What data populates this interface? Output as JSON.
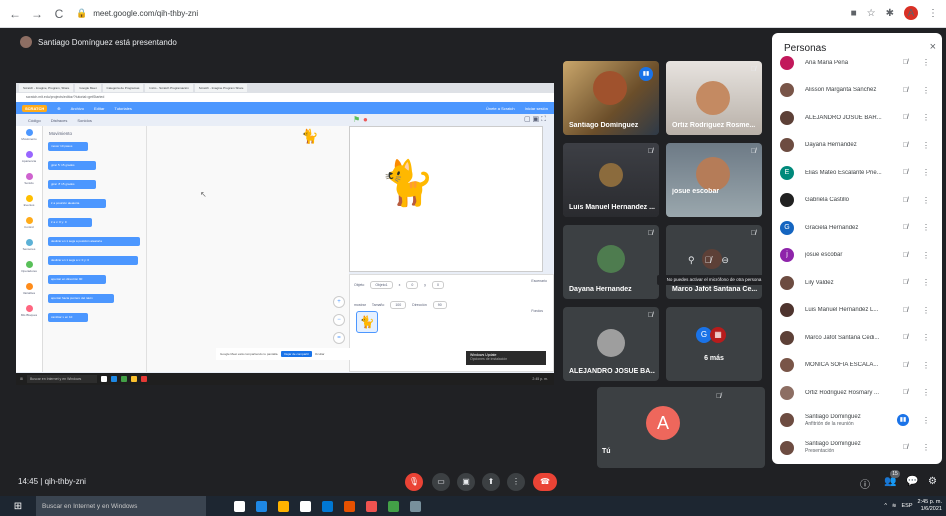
{
  "browser": {
    "back": "←",
    "forward": "→",
    "reload": "C",
    "url": "meet.google.com/qih-thby-zni"
  },
  "meet": {
    "presenter_banner": "Santiago Domínguez está presentando",
    "meeting_time": "14:45",
    "meeting_code": "qih-thby-zni",
    "hover_tooltip": "No puedes activar el micrófono de otra persona"
  },
  "shared_screen": {
    "tabs": [
      "Scratch - Imagine, Program, Share",
      "Google Meet",
      "Categoría de Programas",
      "Inicio - Scratch Programación",
      "Scratch - Imagine Program Share"
    ],
    "address": "scratch.mit.edu/projects/editor/?tutorial=getStarted",
    "menu": [
      "Archivo",
      "Editar",
      "Tutoriales"
    ],
    "menu_right": [
      "Únete a Scratch",
      "Iniciar sesión"
    ],
    "logo": "SCRATCH",
    "editor_tabs": [
      "Código",
      "Disfraces",
      "Sonidos"
    ],
    "categories": [
      {
        "label": "Movimiento",
        "color": "#4c97ff"
      },
      {
        "label": "Apariencia",
        "color": "#9966ff"
      },
      {
        "label": "Sonido",
        "color": "#cf63cf"
      },
      {
        "label": "Eventos",
        "color": "#ffbf00"
      },
      {
        "label": "Control",
        "color": "#ffab19"
      },
      {
        "label": "Sensores",
        "color": "#5cb1d6"
      },
      {
        "label": "Operadores",
        "color": "#59c059"
      },
      {
        "label": "Variables",
        "color": "#ff8c1a"
      },
      {
        "label": "Mis Bloques",
        "color": "#ff6680"
      }
    ],
    "palette_title": "Movimiento",
    "blocks": [
      "mover 10 pasos",
      "girar ↻ 15 grados",
      "girar ↺ 15 grados",
      "ir a posición aleatoria",
      "ir a x: 0 y: 0",
      "deslizar en 1 segs a posición aleatoria",
      "deslizar en 1 segs a x: 0 y: 0",
      "apuntar en dirección 90",
      "apuntar hacia puntero del ratón",
      "cambiar x en 10"
    ],
    "sprite_panel": {
      "sprite_label": "Objeto",
      "sprite_name": "Objeto1",
      "x_label": "x",
      "x_value": "0",
      "y_label": "y",
      "y_value": "0",
      "show_label": "mostrar",
      "size_label": "Tamaño",
      "size_value": "100",
      "dir_label": "Dirección",
      "dir_value": "90",
      "stage_label": "Escenario",
      "sprite_thumb": "Objeto1",
      "backdrops": "Fondos"
    },
    "notice": "Google Meet está compartiendo tu pantalla.",
    "notice_stop": "Dejar de compartir",
    "notice_hide": "Ocultar",
    "update_title": "Windows Update",
    "update_text": "Opciones de instalación",
    "taskbar_search": "Buscar en Internet y en Windows"
  },
  "tiles": [
    {
      "name": "Santiago Domínguez",
      "speaking": true
    },
    {
      "name": "Ortiz Rodriguez Rosme..."
    },
    {
      "name": "Luis Manuel Hernandez ..."
    },
    {
      "name": "josue escobar"
    },
    {
      "name": "Dayana Hernandez"
    },
    {
      "name": "Marco Jafot Santana Ce..."
    },
    {
      "name": "ALEJANDRO JOSUE BA..."
    },
    {
      "more_label": "6 más",
      "initial": "G"
    },
    {
      "name": "Tú",
      "initial": "A"
    }
  ],
  "people_panel": {
    "title": "Personas",
    "close": "×",
    "participants": [
      {
        "name": "Ana Maria Peña",
        "color": "#c2185b"
      },
      {
        "name": "Alisson Margarita Sánchez",
        "color": "#795548"
      },
      {
        "name": "ALEJANDRO JOSUE BAR...",
        "color": "#5d4037"
      },
      {
        "name": "Dayana Hernandez",
        "color": "#6d4c41"
      },
      {
        "name": "Elias Mateo Escalante Prie...",
        "color": "#00897b",
        "initial": "E"
      },
      {
        "name": "Gabriela Castillo",
        "color": "#212121"
      },
      {
        "name": "Graciela Hernandez",
        "color": "#1565c0",
        "initial": "G"
      },
      {
        "name": "josue escobar",
        "color": "#8e24aa",
        "initial": "j"
      },
      {
        "name": "Lily Valdez",
        "color": "#6d4c41"
      },
      {
        "name": "Luis Manuel Hernandez L...",
        "color": "#4e342e"
      },
      {
        "name": "Marco Jafot Santana Cedi...",
        "color": "#5d4037"
      },
      {
        "name": "MONICA SOFIA ESCALA...",
        "color": "#795548"
      },
      {
        "name": "Ortiz Rodriguez Rosmary ...",
        "color": "#8d6e63"
      },
      {
        "name": "Santiago Dominguez",
        "sub": "Anfitrión de la reunión",
        "color": "#6d4c41",
        "speaking": true
      },
      {
        "name": "Santiago Dominguez",
        "sub": "Presentación",
        "color": "#6d4c41"
      }
    ]
  },
  "bottom": {
    "people_count": "15"
  },
  "windows": {
    "search_placeholder": "Buscar en Internet y en Windows",
    "time": "2:45 p. m.",
    "date": "1/6/2021",
    "lang": "ESP"
  }
}
